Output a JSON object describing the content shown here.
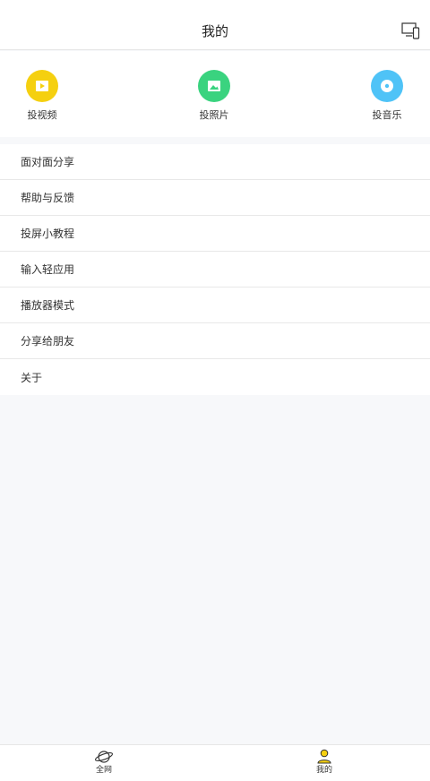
{
  "header": {
    "title": "我的",
    "right_icon": "cast-device-icon"
  },
  "cast_options": [
    {
      "label": "投视频",
      "icon": "video-icon",
      "color": "#f5d010"
    },
    {
      "label": "投照片",
      "icon": "photo-icon",
      "color": "#3ad37f"
    },
    {
      "label": "投音乐",
      "icon": "music-disc-icon",
      "color": "#4fc3f7"
    }
  ],
  "menu": {
    "items": [
      {
        "label": "面对面分享"
      },
      {
        "label": "帮助与反馈"
      },
      {
        "label": "投屏小教程"
      },
      {
        "label": "输入轻应用"
      },
      {
        "label": "播放器模式"
      },
      {
        "label": "分享给朋友"
      },
      {
        "label": "关于"
      }
    ]
  },
  "bottom_nav": {
    "tabs": [
      {
        "label": "全网",
        "icon": "planet-icon",
        "active": false
      },
      {
        "label": "我的",
        "icon": "user-icon",
        "active": true
      }
    ]
  },
  "colors": {
    "background": "#f7f8fa",
    "accent_yellow": "#f5d010",
    "accent_green": "#3ad37f",
    "accent_blue": "#4fc3f7"
  }
}
